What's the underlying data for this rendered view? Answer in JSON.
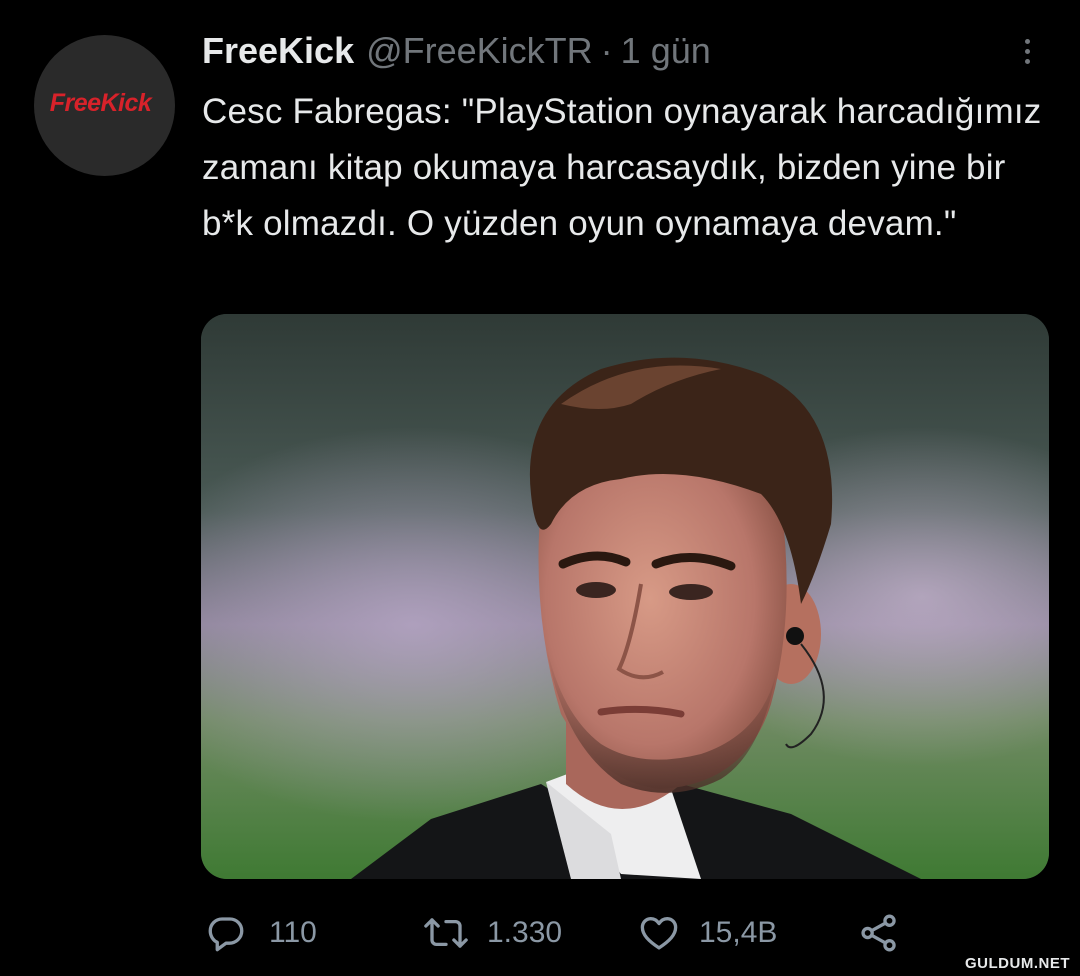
{
  "tweet": {
    "display_name": "FreeKick",
    "handle": "@FreeKickTR",
    "separator": "·",
    "time": "1 gün",
    "text": "Cesc Fabregas: \"PlayStation oynayarak harcadığımız zamanı kitap okumaya harcasaydık, bizden yine bir b*k olmazdı. O yüzden oyun oynamaya devam.\"",
    "avatar_logo_text": "FreeKick",
    "avatar_icon": "freekick-logo",
    "media_icon": "photo"
  },
  "actions": {
    "reply": {
      "icon": "reply-icon",
      "count": "110"
    },
    "retweet": {
      "icon": "retweet-icon",
      "count": "1.330"
    },
    "like": {
      "icon": "heart-icon",
      "count": "15,4B"
    },
    "share": {
      "icon": "share-icon"
    }
  },
  "watermark": "GULDUM.NET",
  "colors": {
    "background": "#000000",
    "text": "#e7e9ea",
    "secondary": "#71767b",
    "brand_red": "#d8222a"
  }
}
